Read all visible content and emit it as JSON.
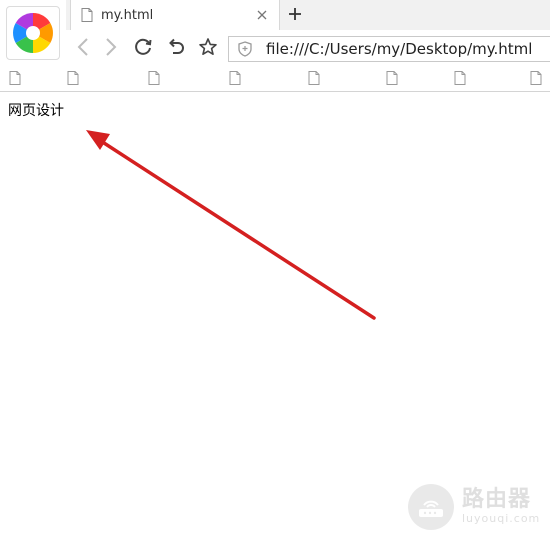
{
  "browser": {
    "tab": {
      "title": "my.html"
    },
    "address_bar": {
      "url": "file:///C:/Users/my/Desktop/my.html"
    },
    "bookmark_count": 8
  },
  "page": {
    "body_text": "网页设计"
  },
  "annotation": {
    "arrow_color": "#d42020"
  },
  "watermark": {
    "text_cn": "路由器",
    "text_en": "luyouqi.com"
  },
  "icons": {
    "logo": "browser-logo-icon",
    "tab": "page-icon",
    "close": "close-icon",
    "new_tab": "plus-icon",
    "back": "back-icon",
    "forward": "forward-icon",
    "reload": "reload-icon",
    "undo": "undo-icon",
    "star": "star-icon",
    "security": "shield-icon",
    "bookmark": "page-icon"
  }
}
